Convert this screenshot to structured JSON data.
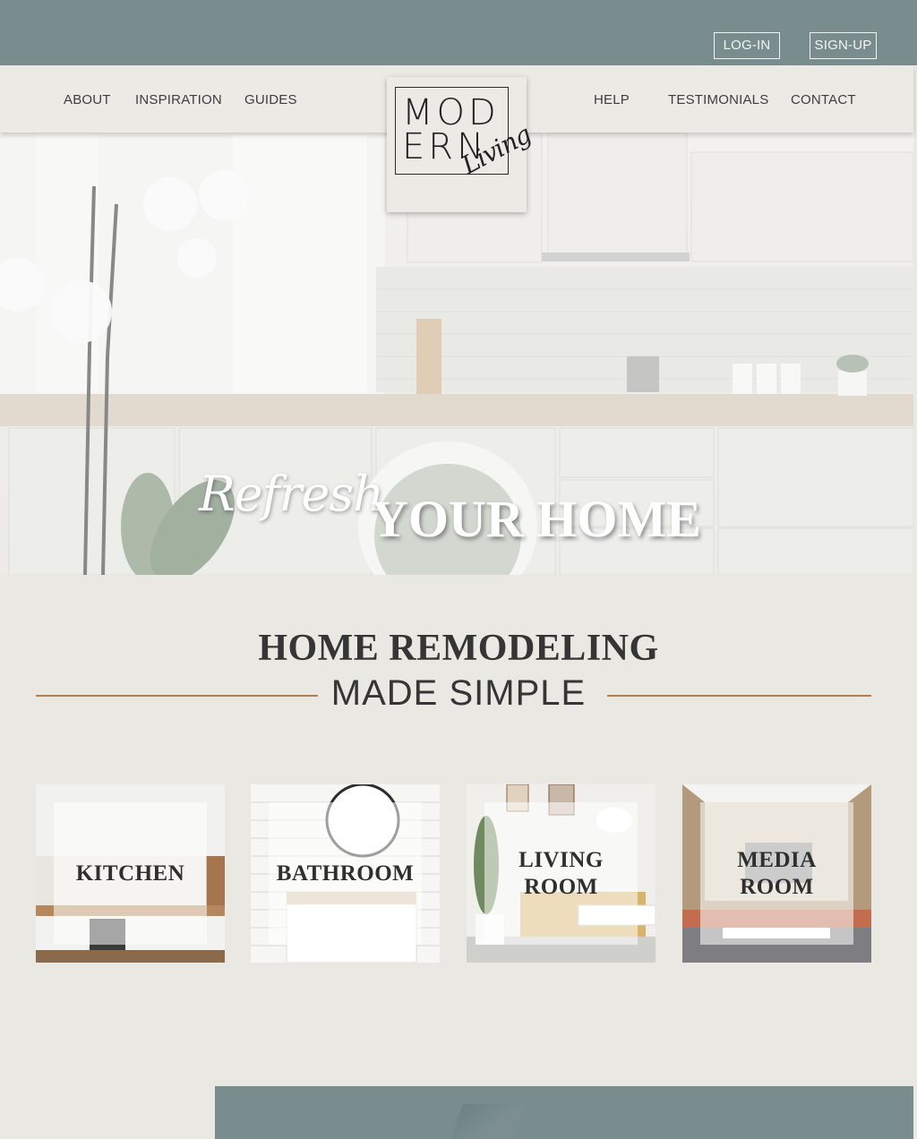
{
  "auth": {
    "login": "LOG-IN",
    "signup": "SIGN-UP"
  },
  "nav": {
    "left": [
      "ABOUT",
      "INSPIRATION",
      "GUIDES"
    ],
    "right": [
      "HELP",
      "TESTIMONIALS",
      "CONTACT"
    ]
  },
  "logo": {
    "line1": "MOD",
    "line2": "ERN",
    "script": "Living"
  },
  "hero": {
    "script": "Refresh",
    "title": "YOUR HOME"
  },
  "section": {
    "title": "HOME REMODELING",
    "subtitle": "MADE SIMPLE"
  },
  "tiles": [
    {
      "label": "KITCHEN"
    },
    {
      "label": "BATHROOM"
    },
    {
      "label_line1": "LIVING",
      "label_line2": "ROOM"
    },
    {
      "label_line1": "MEDIA",
      "label_line2": "ROOM"
    }
  ],
  "colors": {
    "sage": "#7a8d8e",
    "cream": "#e9e8e3",
    "accent_rule": "#b07f54",
    "text": "#353535"
  }
}
